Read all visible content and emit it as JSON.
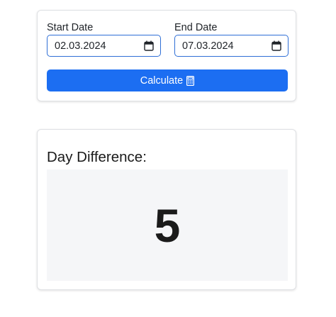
{
  "form": {
    "start_label": "Start Date",
    "start_value": "02.03.2024",
    "end_label": "End Date",
    "end_value": "07.03.2024",
    "calculate_label": "Calculate",
    "calculate_icon": "calculator-icon",
    "date_picker_icon": "calendar-icon"
  },
  "result": {
    "title": "Day Difference:",
    "value": "5"
  },
  "colors": {
    "accent": "#1c6ef2",
    "input_border": "#2f6fd6",
    "result_background": "#f5f6f8"
  }
}
